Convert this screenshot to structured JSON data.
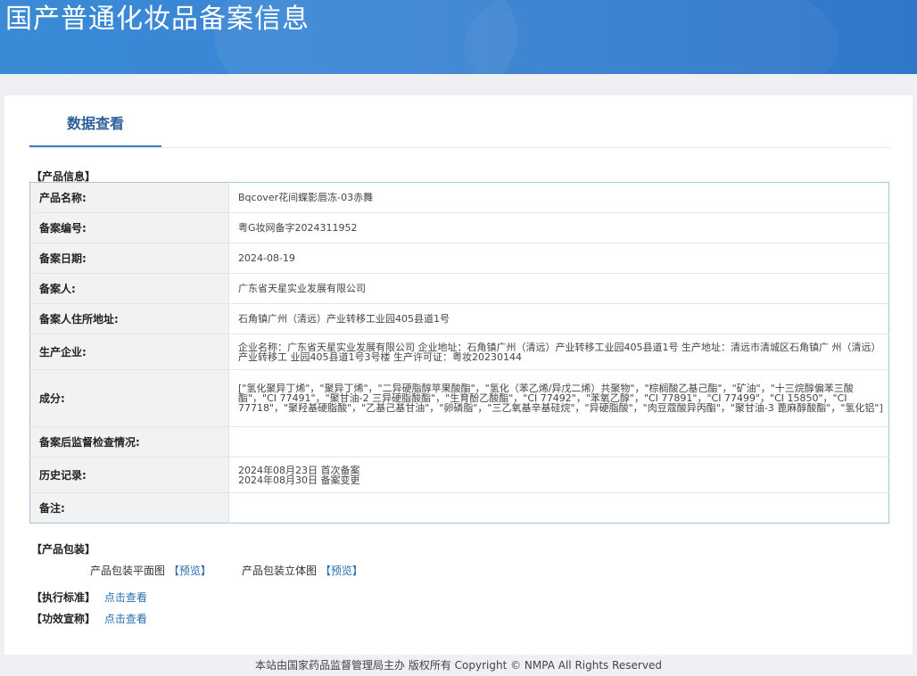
{
  "header": {
    "title": "国产普通化妆品备案信息"
  },
  "tabs": [
    {
      "label": "数据查看"
    }
  ],
  "product_info": {
    "section_label": "【产品信息】",
    "rows": [
      {
        "label": "产品名称:",
        "value": "Bqcover花间蝶影唇冻-03赤舞"
      },
      {
        "label": "备案编号:",
        "value": "粤G妆网备字2024311952"
      },
      {
        "label": "备案日期:",
        "value": "2024-08-19"
      },
      {
        "label": "备案人:",
        "value": "广东省天星实业发展有限公司"
      },
      {
        "label": "备案人住所地址:",
        "value": "石角镇广州（清远）产业转移工业园405县道1号"
      },
      {
        "label": "生产企业:",
        "value": "企业名称：广东省天星实业发展有限公司 企业地址：石角镇广州（清远）产业转移工业园405县道1号 生产地址：清远市清城区石角镇广 州（清远）产业转移工 业园405县道1号3号楼 生产许可证：粤妆20230144"
      },
      {
        "label": "成分:",
        "value": "[\"氢化聚异丁烯\"，\"聚异丁烯\"，\"二异硬脂醇苹果酸酯\"，\"氢化（苯乙烯/异戊二烯）共聚物\"，\"棕榈酸乙基己酯\"，\"矿油\"，\"十三烷醇偏苯三酸酯\"，\"CI 77491\"，\"聚甘油-2 三异硬脂酸酯\"，\"生育酚乙酸酯\"，\"CI 77492\"，\"苯氧乙醇\"，\"CI 77891\"，\"CI 77499\"，\"CI 15850\"，\"CI 77718\"，\"聚羟基硬脂酸\"，\"乙基己基甘油\"，\"卵磷脂\"，\"三乙氧基辛基硅烷\"，\"异硬脂酸\"，\"肉豆蔻酸异丙酯\"，\"聚甘油-3 蓖麻醇酸酯\"，\"氢化铝\"]"
      },
      {
        "label": "备案后监督检查情况:",
        "value": ""
      },
      {
        "label": "历史记录:",
        "value_lines": [
          "2024年08月23日 首次备案",
          "2024年08月30日 备案变更"
        ]
      },
      {
        "label": "备注:",
        "value": ""
      }
    ]
  },
  "packaging": {
    "section_label": "【产品包装】",
    "flat_label": "产品包装平面图",
    "flat_link": "【预览】",
    "solid_label": "产品包装立体图",
    "solid_link": "【预览】"
  },
  "standard": {
    "label": "【执行标准】",
    "link": "点击查看"
  },
  "claims": {
    "label": "【功效宣称】",
    "link": "点击查看"
  },
  "footer": {
    "text": "本站由国家药品监督管理局主办 版权所有 Copyright © NMPA All Rights Reserved"
  },
  "colors": {
    "banner": "#3a8ad6",
    "link": "#2b6cb0",
    "tab_accent": "#3d7fc7",
    "table_border": "#a8c2dc"
  }
}
